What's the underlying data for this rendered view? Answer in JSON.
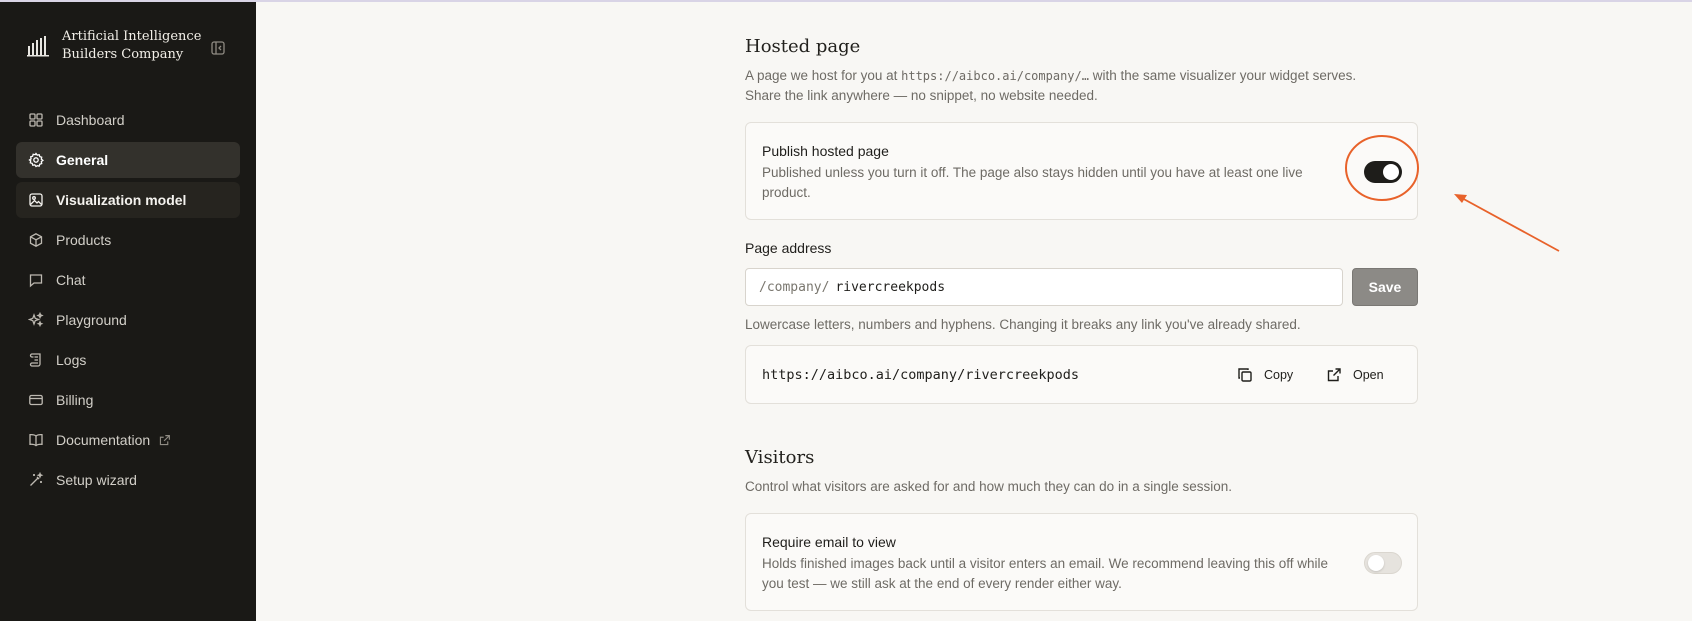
{
  "brand": {
    "name": "Artificial Intelligence Builders Company"
  },
  "sidebar": {
    "items": [
      {
        "label": "Dashboard",
        "icon": "grid-icon"
      },
      {
        "label": "General",
        "icon": "gear-icon"
      },
      {
        "label": "Visualization model",
        "icon": "image-icon"
      },
      {
        "label": "Products",
        "icon": "cube-icon"
      },
      {
        "label": "Chat",
        "icon": "chat-bubble-icon"
      },
      {
        "label": "Playground",
        "icon": "sparkles-icon"
      },
      {
        "label": "Logs",
        "icon": "scroll-icon"
      },
      {
        "label": "Billing",
        "icon": "credit-card-icon"
      },
      {
        "label": "Documentation",
        "icon": "book-icon"
      },
      {
        "label": "Setup wizard",
        "icon": "magic-wand-icon"
      }
    ],
    "active": "General"
  },
  "hosted_page": {
    "title": "Hosted page",
    "desc_prefix": "A page we host for you at",
    "desc_url": "https://aibco.ai/company/…",
    "desc_suffix": "with the same visualizer your widget serves.",
    "desc_line2": "Share the link anywhere — no snippet, no website needed.",
    "publish": {
      "title": "Publish hosted page",
      "desc": "Published unless you turn it off. The page also stays hidden until you have at least one live product.",
      "enabled": true
    },
    "address": {
      "label": "Page address",
      "prefix": "/company/",
      "value": "rivercreekpods",
      "save_label": "Save",
      "hint": "Lowercase letters, numbers and hyphens. Changing it breaks any link you've already shared."
    },
    "link": {
      "url": "https://aibco.ai/company/rivercreekpods",
      "copy_label": "Copy",
      "open_label": "Open"
    }
  },
  "visitors": {
    "title": "Visitors",
    "desc": "Control what visitors are asked for and how much they can do in a single session.",
    "require_email": {
      "title": "Require email to view",
      "desc": "Holds finished images back until a visitor enters an email. We recommend leaving this off while you test — we still ask at the end of every render either way.",
      "enabled": false
    }
  },
  "colors": {
    "sidebar_bg": "#1a1916",
    "page_bg": "#f8f7f4",
    "annotation": "#e8622a",
    "toggle_on": "#1e1d1a"
  }
}
